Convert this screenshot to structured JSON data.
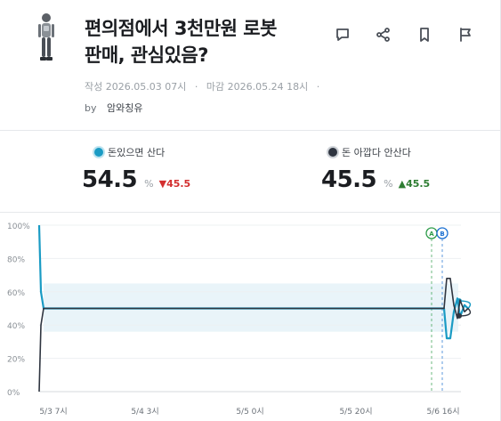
{
  "post": {
    "title_line1": "편의점에서 3천만원 로봇",
    "title_line2": "판매, 관심있음?",
    "created_label": "작성",
    "created": "2026.05.03 07시",
    "deadline_label": "마감",
    "deadline": "2026.05.24 18시",
    "by_label": "by",
    "author": "암와칭유"
  },
  "actions": [
    "comment-icon",
    "share-icon",
    "bookmark-icon",
    "flag-icon"
  ],
  "options": [
    {
      "label": "돈있으면 산다",
      "percent": "54.5",
      "unit": "%",
      "change": "▼45.5",
      "color": "#1a9bc4"
    },
    {
      "label": "돈 아깝다 안산다",
      "percent": "45.5",
      "unit": "%",
      "change": "▲45.5",
      "color": "#2f3540"
    }
  ],
  "chart_data": {
    "type": "line",
    "y_ticks": [
      "100%",
      "80%",
      "60%",
      "40%",
      "20%",
      "0%"
    ],
    "x_ticks": [
      "5/3 7시",
      "5/4 3시",
      "5/5 0시",
      "5/5 20시",
      "5/6 16시"
    ],
    "ylim": [
      0,
      100
    ],
    "markers": [
      "A",
      "B"
    ],
    "series": [
      {
        "color": "#1a9bc4",
        "points": [
          [
            0,
            100
          ],
          [
            2,
            60
          ],
          [
            5,
            50
          ],
          [
            455,
            50
          ],
          [
            458,
            32
          ],
          [
            462,
            32
          ],
          [
            466,
            48
          ],
          [
            470,
            56
          ],
          [
            473,
            45
          ],
          [
            478,
            52
          ],
          [
            482,
            50
          ]
        ]
      },
      {
        "color": "#2f3540",
        "points": [
          [
            0,
            0
          ],
          [
            2,
            40
          ],
          [
            5,
            50
          ],
          [
            455,
            50
          ],
          [
            458,
            68
          ],
          [
            462,
            68
          ],
          [
            466,
            52
          ],
          [
            470,
            44
          ],
          [
            473,
            55
          ],
          [
            478,
            48
          ],
          [
            482,
            50
          ]
        ]
      }
    ],
    "end_values": [
      54.5,
      45.5
    ]
  }
}
